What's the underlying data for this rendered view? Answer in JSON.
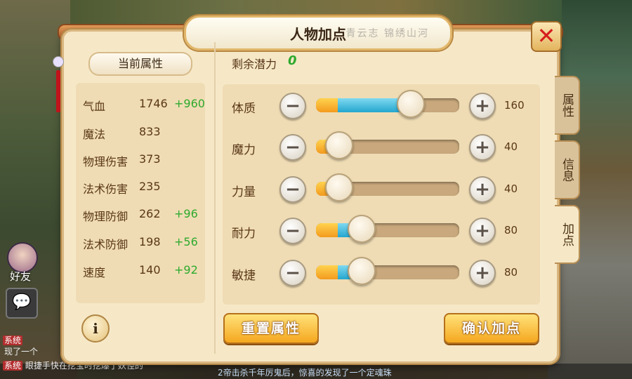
{
  "window": {
    "title": "人物加点",
    "title_decoration": "青云志 锦绣山河"
  },
  "left": {
    "header": "当前属性",
    "attributes": [
      {
        "name": "气血",
        "value": "1746",
        "bonus": "+960"
      },
      {
        "name": "魔法",
        "value": "833",
        "bonus": ""
      },
      {
        "name": "物理伤害",
        "value": "373",
        "bonus": ""
      },
      {
        "name": "法术伤害",
        "value": "235",
        "bonus": ""
      },
      {
        "name": "物理防御",
        "value": "262",
        "bonus": "+96"
      },
      {
        "name": "法术防御",
        "value": "198",
        "bonus": "+56"
      },
      {
        "name": "速度",
        "value": "140",
        "bonus": "+92"
      }
    ],
    "info_icon": "i"
  },
  "right": {
    "potential_label": "剩余潜力",
    "potential_value": "0",
    "stats": [
      {
        "name": "体质",
        "value": "160",
        "base_fraction": 0.15,
        "total_fraction": 0.65
      },
      {
        "name": "魔力",
        "value": "40",
        "base_fraction": 0.15,
        "total_fraction": 0.15
      },
      {
        "name": "力量",
        "value": "40",
        "base_fraction": 0.15,
        "total_fraction": 0.15
      },
      {
        "name": "耐力",
        "value": "80",
        "base_fraction": 0.15,
        "total_fraction": 0.31
      },
      {
        "name": "敏捷",
        "value": "80",
        "base_fraction": 0.15,
        "total_fraction": 0.31
      }
    ],
    "minus_glyph": "−",
    "plus_glyph": "+",
    "reset_label": "重置属性",
    "confirm_label": "确认加点"
  },
  "tabs": [
    {
      "label": "属性",
      "active": false
    },
    {
      "label": "信息",
      "active": false
    },
    {
      "label": "加点",
      "active": true
    }
  ],
  "close_glyph": "✕",
  "hud": {
    "friend_label": "好友",
    "chat_icon": "💬",
    "chat_lines": [
      {
        "tag": "系统",
        "text": "现了一个"
      },
      {
        "tag": "系统",
        "text": "眼捷手快在挖宝时挖爆了妖怪的"
      },
      {
        "tag": "",
        "text": "2帝击杀千年厉鬼后，惊喜的发现了一个定魂珠"
      }
    ]
  },
  "colors": {
    "bonus_green": "#2eaa2e",
    "fill_base": "#f39a1e",
    "fill_add": "#24a6cf",
    "close_red": "#d61d1d"
  }
}
